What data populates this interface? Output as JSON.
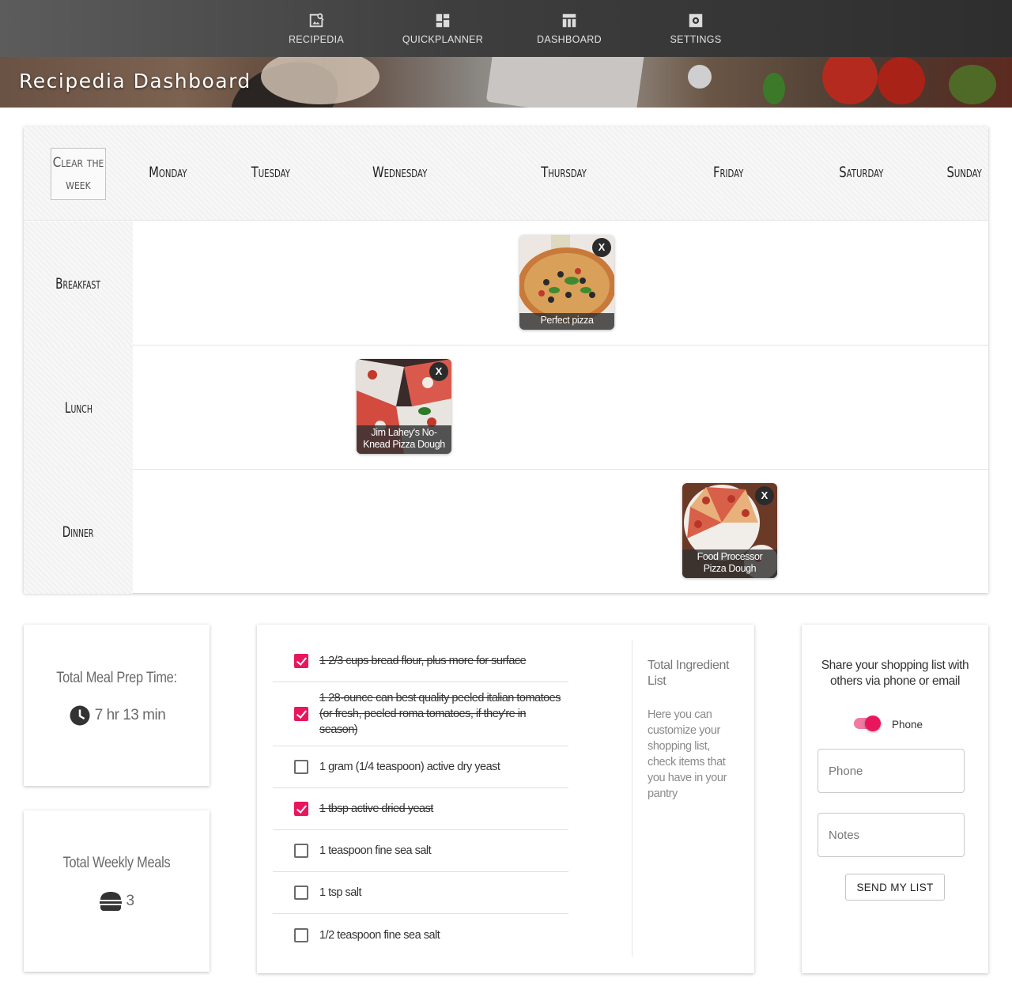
{
  "nav": {
    "items": [
      {
        "label": "RECIPEDIA",
        "icon": "image-search-icon"
      },
      {
        "label": "QUICKPLANNER",
        "icon": "dashboard-grid-icon"
      },
      {
        "label": "DASHBOARD",
        "icon": "table-icon"
      },
      {
        "label": "SETTINGS",
        "icon": "gear-icon"
      }
    ]
  },
  "hero": {
    "title": "Recipedia Dashboard"
  },
  "planner": {
    "clear_label": "Clear the week",
    "days": [
      "Monday",
      "Tuesday",
      "Wednesday",
      "Thursday",
      "Friday",
      "Saturday",
      "Sunday"
    ],
    "meals": [
      "Breakfast",
      "Lunch",
      "Dinner"
    ],
    "recipes": [
      {
        "meal": "Breakfast",
        "day": "Thursday",
        "title": "Perfect pizza",
        "remove": "X"
      },
      {
        "meal": "Lunch",
        "day": "Wednesday",
        "title": "Jim Lahey's No-Knead Pizza Dough",
        "remove": "X"
      },
      {
        "meal": "Dinner",
        "day": "Friday",
        "title": "Food Processor Pizza Dough",
        "remove": "X"
      }
    ]
  },
  "stats": {
    "prep": {
      "title": "Total Meal Prep Time:",
      "value": "7 hr 13 min",
      "icon": "clock-icon"
    },
    "meals": {
      "title": "Total Weekly Meals",
      "value": "3",
      "icon": "burger-icon"
    }
  },
  "ingredients": {
    "side_title": "Total Ingredient List",
    "side_desc": "Here you can customize your shopping list, check items that you have in your pantry",
    "items": [
      {
        "text": "1 2/3 cups bread flour, plus more for surface",
        "checked": true
      },
      {
        "text": "1 28-ounce can best quality peeled italian tomatoes (or fresh, peeled roma tomatoes, if they're in season)",
        "checked": true
      },
      {
        "text": "1 gram (1/4 teaspoon) active dry yeast",
        "checked": false
      },
      {
        "text": "1 tbsp active dried yeast",
        "checked": true
      },
      {
        "text": "1 teaspoon fine sea salt",
        "checked": false
      },
      {
        "text": "1 tsp salt",
        "checked": false
      },
      {
        "text": "1/2 teaspoon fine sea salt",
        "checked": false
      }
    ]
  },
  "share": {
    "title": "Share your shopping list with others via phone or email",
    "toggle_label": "Phone",
    "toggle_on": true,
    "phone_placeholder": "Phone",
    "notes_placeholder": "Notes",
    "send_label": "SEND MY LIST"
  },
  "colors": {
    "accent": "#e8175d",
    "nav_bg": "#3e3e3e"
  }
}
